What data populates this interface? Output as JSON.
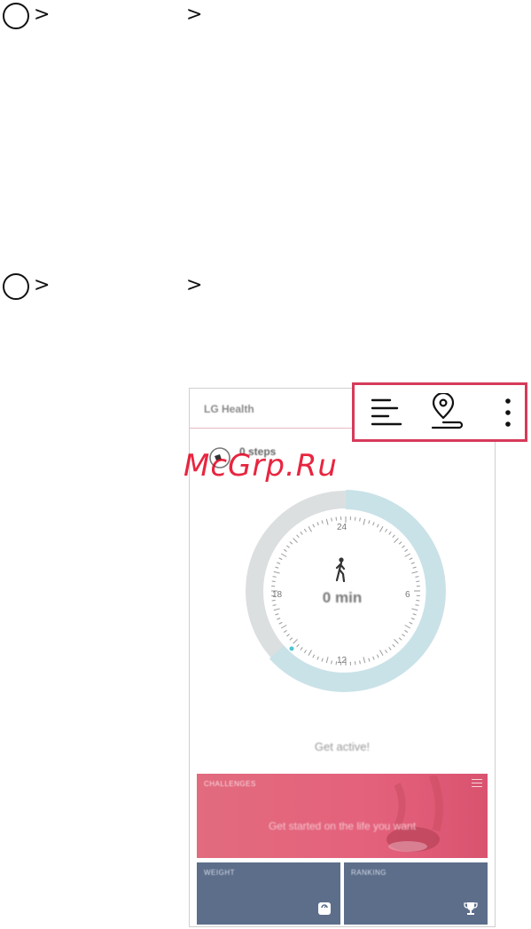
{
  "steps": [
    {
      "chevrons": [
        ">",
        ">"
      ]
    },
    {
      "chevrons": [
        ">",
        ">"
      ]
    }
  ],
  "app": {
    "title": "LG Health",
    "steps_label": "0 steps",
    "clock": {
      "top": "24",
      "right": "6",
      "bottom": "12",
      "left": "18"
    },
    "duration": "0 min",
    "motivation": "Get active!"
  },
  "cards": {
    "challenges_title": "CHALLENGES",
    "challenges_text": "Get started on the life you want",
    "weight_title": "WEIGHT",
    "ranking_title": "RANKING"
  },
  "toolbar_icons": [
    "timeline-icon",
    "route-location-icon",
    "more-vert-icon"
  ],
  "watermark": "McGrp.Ru",
  "colors": {
    "callout_border": "#d63a5a",
    "challenge_card": "#e4617c",
    "stat_card": "#5d6e8a",
    "progress_ring": "#c9e2e8",
    "watermark": "#e4001f"
  }
}
